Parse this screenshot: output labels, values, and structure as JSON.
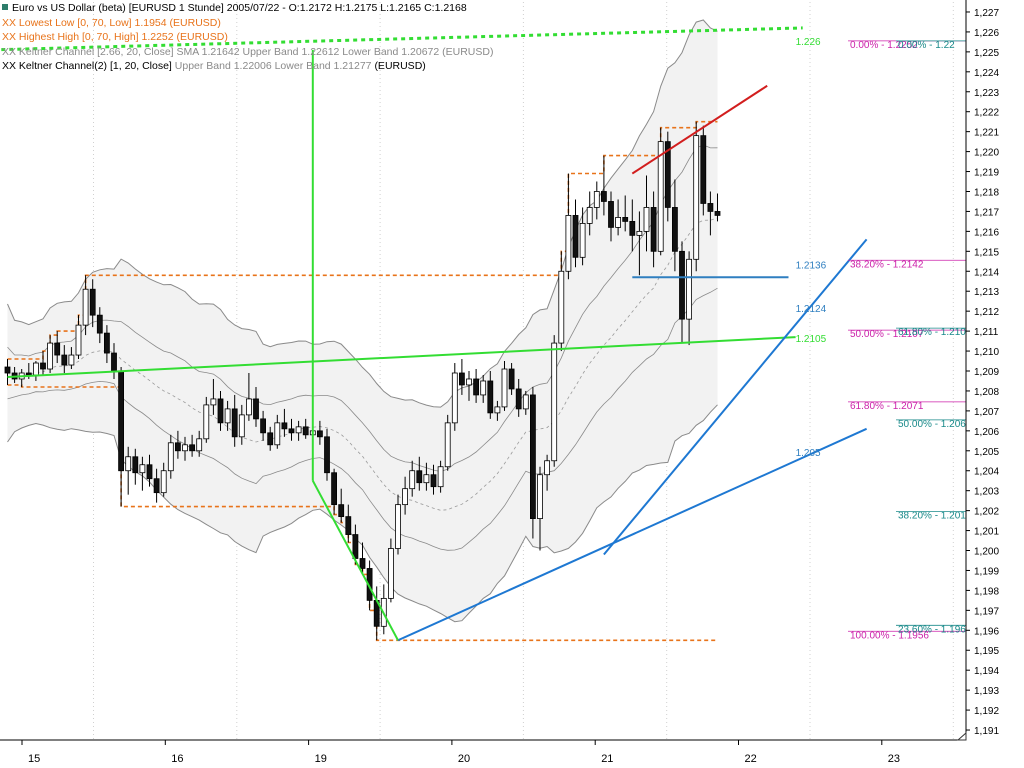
{
  "legend": {
    "title": "Euro vs US Dollar (beta) [EURUSD  1 Stunde] 2005/07/22 - O:1.2172 H:1.2175 L:1.2165 C:1.2168",
    "line1": "XX Lowest Low [0, 70, Low] 1.1954 (EURUSD)",
    "line2": "XX Highest High [0, 70, High] 1.2252 (EURUSD)",
    "line3": "XX Keltner Channel [2.66, 20, Close] SMA 1.21642 Upper Band 1.22612 Lower Band 1.20672 (EURUSD)",
    "line4_a": "XX Keltner Channel(2) [1, 20, Close]",
    "line4_b": "Upper Band 1.22006 Lower Band 1.21277",
    "line4_c": "(EURUSD)"
  },
  "colors": {
    "up": "#ffffff",
    "down": "#111111",
    "candle_edge": "#000000",
    "band_fill": "#f2f2f2",
    "band_line": "#8a8a8a",
    "donchian": "#e8731a",
    "green": "#33dd33",
    "blue": "#1e78d2",
    "red": "#d21e1e",
    "fib_pink": "#cc22aa",
    "fib_teal": "#1a8a8a",
    "steelblue": "#2f7fc0"
  },
  "chart_data": {
    "type": "candlestick",
    "symbol": "EURUSD",
    "timeframe": "1 Stunde",
    "ylim": [
      1.1905,
      1.2275
    ],
    "yticks": [
      "1,191",
      "1,192",
      "1,193",
      "1,194",
      "1,195",
      "1,196",
      "1,197",
      "1,198",
      "1,199",
      "1,200",
      "1,201",
      "1,202",
      "1,203",
      "1,204",
      "1,205",
      "1,206",
      "1,207",
      "1,208",
      "1,209",
      "1,210",
      "1,211",
      "1,212",
      "1,213",
      "1,214",
      "1,215",
      "1,216",
      "1,217",
      "1,218",
      "1,219",
      "1,220",
      "1,221",
      "1,222",
      "1,223",
      "1,224",
      "1,225",
      "1,226",
      "1,227"
    ],
    "xticks": [
      "15",
      "16",
      "19",
      "20",
      "21",
      "22",
      "23"
    ],
    "candles": [
      [
        1.2092,
        1.2096,
        1.2083,
        1.2089
      ],
      [
        1.2089,
        1.2092,
        1.2084,
        1.2086
      ],
      [
        1.2086,
        1.2091,
        1.2082,
        1.2089
      ],
      [
        1.2089,
        1.2094,
        1.2086,
        1.2088
      ],
      [
        1.2088,
        1.2095,
        1.2085,
        1.2094
      ],
      [
        1.2094,
        1.21,
        1.2088,
        1.2091
      ],
      [
        1.2091,
        1.2108,
        1.2089,
        1.2104
      ],
      [
        1.2104,
        1.211,
        1.2094,
        1.2098
      ],
      [
        1.2098,
        1.2103,
        1.2089,
        1.2093
      ],
      [
        1.2093,
        1.2102,
        1.2091,
        1.2098
      ],
      [
        1.2098,
        1.2118,
        1.2096,
        1.2113
      ],
      [
        1.2113,
        1.2138,
        1.2108,
        1.2131
      ],
      [
        1.2131,
        1.2136,
        1.2112,
        1.2118
      ],
      [
        1.2118,
        1.2122,
        1.2104,
        1.2109
      ],
      [
        1.2109,
        1.2113,
        1.2094,
        1.2099
      ],
      [
        1.2099,
        1.2104,
        1.2086,
        1.209
      ],
      [
        1.209,
        1.2092,
        1.2022,
        1.204
      ],
      [
        1.204,
        1.2052,
        1.2028,
        1.2047
      ],
      [
        1.2047,
        1.2051,
        1.2033,
        1.2039
      ],
      [
        1.2039,
        1.2047,
        1.203,
        1.2043
      ],
      [
        1.2043,
        1.2048,
        1.2032,
        1.2036
      ],
      [
        1.2036,
        1.2041,
        1.2024,
        1.2029
      ],
      [
        1.2029,
        1.2044,
        1.2027,
        1.204
      ],
      [
        1.204,
        1.2058,
        1.2036,
        1.2054
      ],
      [
        1.2054,
        1.206,
        1.2046,
        1.205
      ],
      [
        1.205,
        1.2057,
        1.2045,
        1.2053
      ],
      [
        1.2053,
        1.2058,
        1.2047,
        1.205
      ],
      [
        1.205,
        1.206,
        1.2047,
        1.2056
      ],
      [
        1.2056,
        1.2077,
        1.2054,
        1.2073
      ],
      [
        1.2073,
        1.2086,
        1.2068,
        1.2076
      ],
      [
        1.2076,
        1.208,
        1.206,
        1.2064
      ],
      [
        1.2064,
        1.2075,
        1.206,
        1.2071
      ],
      [
        1.2071,
        1.2078,
        1.2052,
        1.2057
      ],
      [
        1.2057,
        1.2073,
        1.2053,
        1.2068
      ],
      [
        1.2068,
        1.2089,
        1.2065,
        1.2076
      ],
      [
        1.2076,
        1.2082,
        1.2062,
        1.2066
      ],
      [
        1.2066,
        1.207,
        1.2055,
        1.2059
      ],
      [
        1.2059,
        1.2062,
        1.205,
        1.2053
      ],
      [
        1.2053,
        1.2068,
        1.2051,
        1.2064
      ],
      [
        1.2064,
        1.2071,
        1.2057,
        1.2061
      ],
      [
        1.2061,
        1.2066,
        1.2055,
        1.2059
      ],
      [
        1.2059,
        1.2065,
        1.2055,
        1.2062
      ],
      [
        1.2062,
        1.2066,
        1.2056,
        1.2058
      ],
      [
        1.2058,
        1.2063,
        1.2055,
        1.206
      ],
      [
        1.206,
        1.2065,
        1.2053,
        1.2057
      ],
      [
        1.2057,
        1.2061,
        1.2035,
        1.2039
      ],
      [
        1.2039,
        1.2041,
        1.2018,
        1.2023
      ],
      [
        1.2023,
        1.2031,
        1.2014,
        1.2017
      ],
      [
        1.2017,
        1.2023,
        1.2004,
        1.2008
      ],
      [
        1.2008,
        1.2013,
        1.1993,
        1.1996
      ],
      [
        1.1996,
        1.2004,
        1.1988,
        1.1991
      ],
      [
        1.1991,
        1.1995,
        1.197,
        1.1975
      ],
      [
        1.1975,
        1.1982,
        1.1955,
        1.1962
      ],
      [
        1.1962,
        1.1983,
        1.1958,
        1.1976
      ],
      [
        1.1976,
        1.2006,
        1.1974,
        1.2001
      ],
      [
        1.2001,
        1.2028,
        1.1998,
        1.2023
      ],
      [
        1.2023,
        1.2037,
        1.2018,
        1.2031
      ],
      [
        1.2031,
        1.2045,
        1.2027,
        1.204
      ],
      [
        1.204,
        1.2047,
        1.203,
        1.2034
      ],
      [
        1.2034,
        1.2044,
        1.203,
        1.2038
      ],
      [
        1.2038,
        1.2043,
        1.2028,
        1.2032
      ],
      [
        1.2032,
        1.2045,
        1.2029,
        1.2042
      ],
      [
        1.2042,
        1.2068,
        1.204,
        1.2064
      ],
      [
        1.2064,
        1.2094,
        1.206,
        1.2089
      ],
      [
        1.2089,
        1.2096,
        1.2078,
        1.2083
      ],
      [
        1.2083,
        1.209,
        1.2075,
        1.2086
      ],
      [
        1.2086,
        1.2091,
        1.2074,
        1.2078
      ],
      [
        1.2078,
        1.2088,
        1.2074,
        1.2085
      ],
      [
        1.2085,
        1.209,
        1.2066,
        1.2069
      ],
      [
        1.2069,
        1.2075,
        1.2065,
        1.2072
      ],
      [
        1.2072,
        1.2095,
        1.207,
        1.2091
      ],
      [
        1.2091,
        1.2094,
        1.2078,
        1.2081
      ],
      [
        1.2081,
        1.2086,
        1.2067,
        1.2071
      ],
      [
        1.2071,
        1.208,
        1.2068,
        1.2078
      ],
      [
        1.2078,
        1.2082,
        1.2006,
        1.2016
      ],
      [
        1.2016,
        1.2042,
        1.2,
        1.2038
      ],
      [
        1.2038,
        1.2048,
        1.203,
        1.2045
      ],
      [
        1.2045,
        1.2108,
        1.2042,
        1.2104
      ],
      [
        1.2104,
        1.215,
        1.21,
        1.214
      ],
      [
        1.214,
        1.2189,
        1.2136,
        1.2168
      ],
      [
        1.2168,
        1.2176,
        1.2142,
        1.2147
      ],
      [
        1.2147,
        1.2172,
        1.2143,
        1.2164
      ],
      [
        1.2164,
        1.218,
        1.2158,
        1.2172
      ],
      [
        1.2172,
        1.2185,
        1.2166,
        1.218
      ],
      [
        1.218,
        1.2198,
        1.2168,
        1.2175
      ],
      [
        1.2175,
        1.218,
        1.2155,
        1.2162
      ],
      [
        1.2162,
        1.2176,
        1.2158,
        1.2167
      ],
      [
        1.2167,
        1.2178,
        1.216,
        1.2165
      ],
      [
        1.2165,
        1.2176,
        1.215,
        1.2158
      ],
      [
        1.2158,
        1.217,
        1.2138,
        1.216
      ],
      [
        1.216,
        1.2188,
        1.215,
        1.2172
      ],
      [
        1.2172,
        1.218,
        1.2142,
        1.215
      ],
      [
        1.215,
        1.2212,
        1.2148,
        1.2205
      ],
      [
        1.2205,
        1.221,
        1.2165,
        1.2172
      ],
      [
        1.2172,
        1.2186,
        1.214,
        1.215
      ],
      [
        1.215,
        1.2155,
        1.2104,
        1.2116
      ],
      [
        1.2116,
        1.215,
        1.2103,
        1.2146
      ],
      [
        1.2146,
        1.2215,
        1.214,
        1.2208
      ],
      [
        1.2208,
        1.2213,
        1.2168,
        1.2174
      ],
      [
        1.2174,
        1.218,
        1.2158,
        1.217
      ],
      [
        1.217,
        1.2179,
        1.2165,
        1.2168
      ]
    ],
    "trendlines": [
      {
        "color": "green",
        "from": [
          "15 11h",
          1.2087
        ],
        "to": [
          "22 02h",
          1.2107
        ]
      },
      {
        "color": "blue",
        "from": [
          "19 18h",
          1.1955
        ],
        "to": [
          "22 12h",
          1.2061
        ]
      },
      {
        "color": "blue",
        "from": [
          "20 23h",
          1.1998
        ],
        "to": [
          "22 12h",
          1.2156
        ]
      },
      {
        "color": "red",
        "from": [
          "21 03h",
          1.2189
        ],
        "to": [
          "21 22h",
          1.2233
        ]
      },
      {
        "color": "steelblue",
        "from": [
          "21 03h",
          1.2137
        ],
        "to": [
          "22 01h",
          1.2137
        ]
      },
      {
        "color": "green",
        "from": [
          "15 09h",
          1.2251
        ],
        "to": [
          "22 03h",
          1.2262
        ],
        "style": "dotted"
      }
    ],
    "value_labels": [
      {
        "text": "1.226",
        "color": "green"
      },
      {
        "text": "1.2136",
        "color": "steelblue"
      },
      {
        "text": "1.2124",
        "color": "steelblue"
      },
      {
        "text": "1.2105",
        "color": "green"
      },
      {
        "text": "1.205",
        "color": "steelblue"
      }
    ],
    "fib_labels": [
      {
        "text": "0.00% - 1.2252",
        "color": "fib_pink",
        "level": 1.2252
      },
      {
        "text": "38.20% - 1.2142",
        "color": "fib_pink",
        "level": 1.2142
      },
      {
        "text": "50.00% - 1.2107",
        "color": "fib_pink",
        "level": 1.2107
      },
      {
        "text": "61.80% - 1.2071",
        "color": "fib_pink",
        "level": 1.2071
      },
      {
        "text": "100.00% - 1.1956",
        "color": "fib_pink",
        "level": 1.1956
      },
      {
        "text": "61.80% - 1.210",
        "color": "fib_teal",
        "level": 1.2108
      },
      {
        "text": "50.00% - 1.206",
        "color": "fib_teal",
        "level": 1.2062
      },
      {
        "text": "38.20% - 1.201",
        "color": "fib_teal",
        "level": 1.2016
      },
      {
        "text": "23.60% - 1.196",
        "color": "fib_teal",
        "level": 1.1959
      },
      {
        "text": "0.00% - 1.22",
        "color": "fib_teal",
        "level": 1.2252
      }
    ]
  }
}
